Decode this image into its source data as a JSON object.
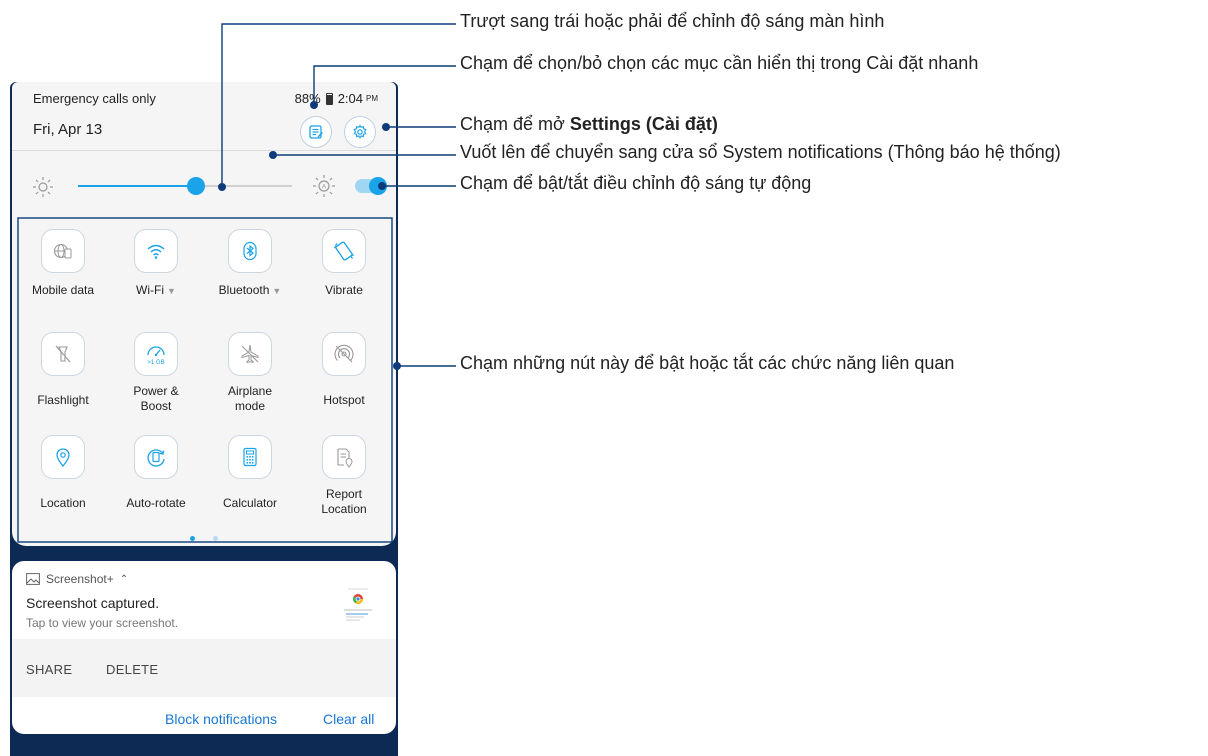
{
  "status_bar": {
    "left_text": "Emergency calls only",
    "battery": "88%",
    "time": "2:04",
    "meridiem": "PM"
  },
  "header": {
    "date": "Fri, Apr 13"
  },
  "brightness": {
    "level": 0.55,
    "auto_enabled": true
  },
  "tiles": [
    {
      "label": "Mobile data",
      "icon": "globe-sim-icon",
      "dropdown": false
    },
    {
      "label": "Wi-Fi",
      "icon": "wifi-icon",
      "dropdown": true
    },
    {
      "label": "Bluetooth",
      "icon": "bluetooth-icon",
      "dropdown": true
    },
    {
      "label": "Vibrate",
      "icon": "vibrate-icon",
      "dropdown": false
    },
    {
      "label": "Flashlight",
      "icon": "flashlight-off-icon",
      "dropdown": false
    },
    {
      "label": "Power &\nBoost",
      "icon": "boost-gauge-icon",
      "dropdown": false,
      "badge": ">1 GB"
    },
    {
      "label": "Airplane\nmode",
      "icon": "airplane-icon",
      "dropdown": false
    },
    {
      "label": "Hotspot",
      "icon": "hotspot-off-icon",
      "dropdown": false
    },
    {
      "label": "Location",
      "icon": "location-pin-icon",
      "dropdown": false
    },
    {
      "label": "Auto-rotate",
      "icon": "auto-rotate-icon",
      "dropdown": false
    },
    {
      "label": "Calculator",
      "icon": "calculator-icon",
      "dropdown": false
    },
    {
      "label": "Report\nLocation",
      "icon": "report-location-icon",
      "dropdown": false
    }
  ],
  "page_dots": {
    "count": 2,
    "active": 0
  },
  "notification": {
    "app_name": "Screenshot+",
    "title": "Screenshot captured.",
    "text": "Tap to view your screenshot.",
    "actions": [
      "SHARE",
      "DELETE"
    ]
  },
  "footer": {
    "block_label": "Block notifications",
    "clear_label": "Clear all"
  },
  "callouts": {
    "brightness_slider": "Trượt sang trái hoặc phải để chỉnh độ sáng màn hình",
    "edit_quick_settings": "Chạm để chọn/bỏ chọn các mục cần hiển thị trong Cài đặt nhanh",
    "open_settings_prefix": "Chạm để mở ",
    "open_settings_bold": "Settings (Cài đặt)",
    "swipe_up": "Vuốt lên để chuyển sang cửa sổ System notifications (Thông báo hệ thống)",
    "auto_brightness": "Chạm để bật/tắt điều chỉnh độ sáng tự động",
    "tiles": "Chạm những nút này để bật hoặc tắt các chức năng liên quan"
  },
  "colors": {
    "accent": "#1aa3e8",
    "callout_line": "#0d3b7a",
    "link": "#1976d2",
    "phone_frame": "#0d2a55"
  }
}
